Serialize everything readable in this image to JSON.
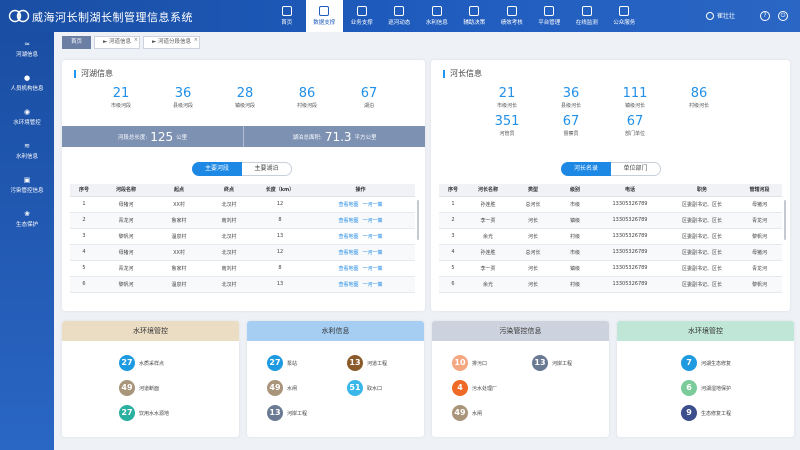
{
  "header": {
    "title": "威海河长制湖长制管理信息系统",
    "user": "崔壮壮",
    "nav": [
      {
        "label": "首页"
      },
      {
        "label": "数据支撑"
      },
      {
        "label": "业务支撑"
      },
      {
        "label": "巡河动态"
      },
      {
        "label": "水利信息"
      },
      {
        "label": "辅助决策"
      },
      {
        "label": "绩效考核"
      },
      {
        "label": "平台管理"
      },
      {
        "label": "在线监测"
      },
      {
        "label": "公众服务"
      }
    ],
    "active_nav": 1
  },
  "sidebar": {
    "items": [
      {
        "label": "河湖信息",
        "icon": "wave-icon"
      },
      {
        "label": "人员机构信息",
        "icon": "person-icon"
      },
      {
        "label": "水环境管控",
        "icon": "drop-icon"
      },
      {
        "label": "水利信息",
        "icon": "water-icon"
      },
      {
        "label": "污染管控信息",
        "icon": "factory-icon"
      },
      {
        "label": "生态保护",
        "icon": "leaf-icon"
      }
    ]
  },
  "breadcrumbs": [
    {
      "label": "首页"
    },
    {
      "label": "► 河道信息"
    },
    {
      "label": "► 河道分段信息"
    }
  ],
  "river_panel": {
    "title": "河湖信息",
    "stats": [
      {
        "value": "21",
        "label": "市级河段"
      },
      {
        "value": "36",
        "label": "县级河段"
      },
      {
        "value": "28",
        "label": "镇级河段"
      },
      {
        "value": "86",
        "label": "村级河段"
      },
      {
        "value": "67",
        "label": "湖泊"
      }
    ],
    "total_length_label": "河段总长度:",
    "total_length_value": "125",
    "total_length_unit": "公里",
    "lake_area_label": "湖泊总面积:",
    "lake_area_value": "71.3",
    "lake_area_unit": "平方公里",
    "tabs": [
      "主要河段",
      "主要湖泊"
    ],
    "columns": [
      "序号",
      "河段名称",
      "起点",
      "终点",
      "长度（km）",
      "操作"
    ],
    "action_map": "查看地图",
    "action_policy": "一河一策",
    "rows": [
      {
        "no": "1",
        "name": "母猪河",
        "start": "XX村",
        "end": "北汉村",
        "len": "12"
      },
      {
        "no": "2",
        "name": "青龙河",
        "start": "鲁家村",
        "end": "南刘村",
        "len": "8"
      },
      {
        "no": "3",
        "name": "黎帆河",
        "start": "温泉村",
        "end": "北汉村",
        "len": "13"
      },
      {
        "no": "4",
        "name": "母猪河",
        "start": "XX村",
        "end": "北汉村",
        "len": "12"
      },
      {
        "no": "5",
        "name": "青龙河",
        "start": "鲁家村",
        "end": "南刘村",
        "len": "8"
      },
      {
        "no": "6",
        "name": "黎帆河",
        "start": "温泉村",
        "end": "北汉村",
        "len": "13"
      }
    ]
  },
  "chief_panel": {
    "title": "河长信息",
    "stats": [
      {
        "value": "21",
        "label": "市级河长"
      },
      {
        "value": "36",
        "label": "县级河长"
      },
      {
        "value": "111",
        "label": "镇级河长"
      },
      {
        "value": "86",
        "label": "村级河长"
      },
      {
        "value": "351",
        "label": "河管员"
      },
      {
        "value": "67",
        "label": "督察员"
      },
      {
        "value": "67",
        "label": "部门单位"
      }
    ],
    "tabs": [
      "河长名录",
      "单位部门"
    ],
    "columns": [
      "序号",
      "河长名称",
      "类型",
      "级别",
      "电话",
      "职务",
      "管辖河段"
    ],
    "rows": [
      {
        "no": "1",
        "name": "孙连胜",
        "type": "总河长",
        "level": "市级",
        "phone": "13305326789",
        "duty": "区委副书记、区长",
        "river": "母猪河"
      },
      {
        "no": "2",
        "name": "李一贾",
        "type": "河长",
        "level": "镇级",
        "phone": "13305326789",
        "duty": "区委副书记、区长",
        "river": "青龙河"
      },
      {
        "no": "3",
        "name": "余光",
        "type": "河长",
        "level": "村级",
        "phone": "13305326789",
        "duty": "区委副书记、区长",
        "river": "黎帆河"
      },
      {
        "no": "4",
        "name": "孙连胜",
        "type": "总河长",
        "level": "市级",
        "phone": "13305326789",
        "duty": "区委副书记、区长",
        "river": "母猪河"
      },
      {
        "no": "5",
        "name": "李一贾",
        "type": "河长",
        "level": "镇级",
        "phone": "13305326789",
        "duty": "区委副书记、区长",
        "river": "青龙河"
      },
      {
        "no": "6",
        "name": "余光",
        "type": "河长",
        "level": "村级",
        "phone": "13305326789",
        "duty": "区委副书记、区长",
        "river": "黎帆河"
      }
    ]
  },
  "cards": [
    {
      "title": "水环境管控",
      "color": "#ebdcc4",
      "items": [
        {
          "value": "27",
          "label": "水质采样点",
          "color": "#1e9be0"
        },
        {
          "value": "49",
          "label": "河道断面",
          "color": "#a8957a"
        },
        {
          "value": "27",
          "label": "饮用水水源地",
          "color": "#2ab0a0"
        }
      ]
    },
    {
      "title": "水利信息",
      "color": "#a6cef3",
      "items": [
        {
          "value": "27",
          "label": "泵站",
          "color": "#1e9be0"
        },
        {
          "value": "13",
          "label": "河道工程",
          "color": "#8b5a2b"
        },
        {
          "value": "49",
          "label": "水闸",
          "color": "#a8957a"
        },
        {
          "value": "51",
          "label": "取水口",
          "color": "#39b7ea"
        },
        {
          "value": "13",
          "label": "河岸工程",
          "color": "#6b7a93"
        }
      ]
    },
    {
      "title": "污染管控信息",
      "color": "#cdd3de",
      "items": [
        {
          "value": "10",
          "label": "排污口",
          "color": "#f5a782"
        },
        {
          "value": "13",
          "label": "河岸工程",
          "color": "#6b7a93"
        },
        {
          "value": "4",
          "label": "污水处理厂",
          "color": "#ef6a26"
        },
        {
          "value": "49",
          "label": "水闸",
          "color": "#a8957a"
        }
      ]
    },
    {
      "title": "水环境管控",
      "color": "#bfe6d6",
      "items": [
        {
          "value": "7",
          "label": "河湖生态修复",
          "color": "#1e9be0"
        },
        {
          "value": "6",
          "label": "河湖湿地保护",
          "color": "#7ccb9b"
        },
        {
          "value": "9",
          "label": "生态修复工程",
          "color": "#3d4e8c"
        }
      ]
    }
  ]
}
